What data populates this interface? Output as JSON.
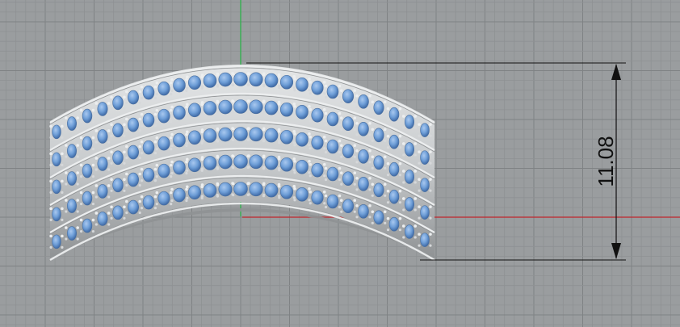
{
  "viewport": {
    "background_color": "#9a9d9f",
    "minor_grid_color": "#8e9193",
    "major_grid_color": "#7f8284",
    "x_axis_color": "#c0262c",
    "y_axis_color": "#2db34a"
  },
  "model": {
    "object": "pave-set-ring",
    "stone_rows": 5,
    "metal_color": "#c9ccce",
    "metal_shadow_color": "#8f9294",
    "stone_color": "#6f9fd8",
    "stone_highlight_color": "#a9c8ef",
    "stone_shadow_color": "#3f6aa6"
  },
  "dimension": {
    "label": "11.08",
    "line_color": "#111111"
  }
}
